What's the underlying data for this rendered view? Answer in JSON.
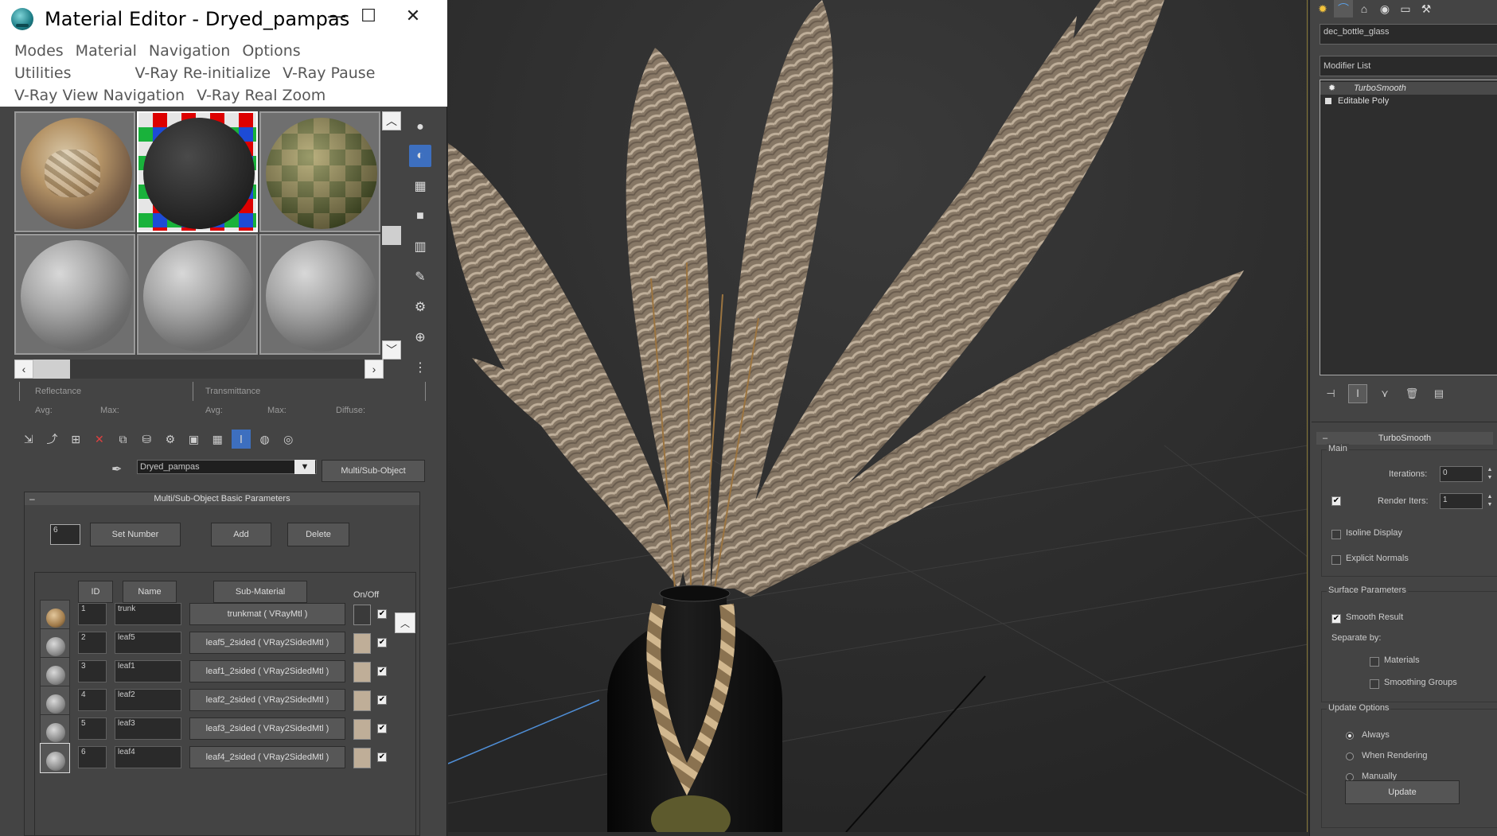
{
  "material_editor": {
    "title": "Material Editor - Dryed_pampas",
    "window_buttons": {
      "minimize": "—",
      "maximize": "☐",
      "close": "✕"
    },
    "menu": [
      "Modes",
      "Material",
      "Navigation",
      "Options",
      "Utilities",
      "V-Ray Re-initialize",
      "V-Ray Pause",
      "V-Ray View Navigation",
      "V-Ray Real Zoom"
    ],
    "slot_preview": {
      "labels": [
        "Reflectance",
        "Avg:",
        "Max:",
        "Transmittance",
        "Avg:",
        "Max:",
        "Diffuse:"
      ]
    },
    "material_name": "Dryed_pampas",
    "material_type_button": "Multi/Sub-Object",
    "rollout": {
      "title": "Multi/Sub-Object Basic Parameters",
      "collapse_symbol": "–",
      "number_field": "6",
      "buttons": {
        "set_number": "Set Number",
        "add": "Add",
        "delete": "Delete"
      },
      "columns": {
        "id": "ID",
        "name": "Name",
        "sub_material": "Sub-Material",
        "on_off": "On/Off"
      },
      "rows": [
        {
          "id": "1",
          "name": "trunk",
          "sub_material": "trunkmat  ( VRayMtl )",
          "swatch": "#3a3a3a",
          "on": "✔"
        },
        {
          "id": "2",
          "name": "leaf5",
          "sub_material": "leaf5_2sided  ( VRay2SidedMtl )",
          "swatch": "#bfae98",
          "on": "✔"
        },
        {
          "id": "3",
          "name": "leaf1",
          "sub_material": "leaf1_2sided  ( VRay2SidedMtl )",
          "swatch": "#bfae98",
          "on": "✔"
        },
        {
          "id": "4",
          "name": "leaf2",
          "sub_material": "leaf2_2sided  ( VRay2SidedMtl )",
          "swatch": "#bfae98",
          "on": "✔"
        },
        {
          "id": "5",
          "name": "leaf3",
          "sub_material": "leaf3_2sided  ( VRay2SidedMtl )",
          "swatch": "#bfae98",
          "on": "✔"
        },
        {
          "id": "6",
          "name": "leaf4",
          "sub_material": "leaf4_2sided  ( VRay2SidedMtl )",
          "swatch": "#bfae98",
          "on": "✔"
        }
      ]
    }
  },
  "command_panel": {
    "object_name": "dec_bottle_glass",
    "modifier_list": "Modifier List",
    "stack": [
      "TurboSmooth",
      "Editable Poly"
    ],
    "turbosmooth": {
      "title": "TurboSmooth",
      "collapse_symbol": "–",
      "main_label": "Main",
      "iterations_label": "Iterations:",
      "iterations_value": "0",
      "render_iters_label": "Render Iters:",
      "render_iters_value": "1",
      "isoline_display": "Isoline Display",
      "explicit_normals": "Explicit Normals",
      "surface_params_label": "Surface Parameters",
      "smooth_result": "Smooth Result",
      "separate_by": "Separate by:",
      "materials": "Materials",
      "smoothing_groups": "Smoothing Groups",
      "update_options_label": "Update Options",
      "always": "Always",
      "when_rendering": "When Rendering",
      "manually": "Manually",
      "update_button": "Update"
    }
  }
}
